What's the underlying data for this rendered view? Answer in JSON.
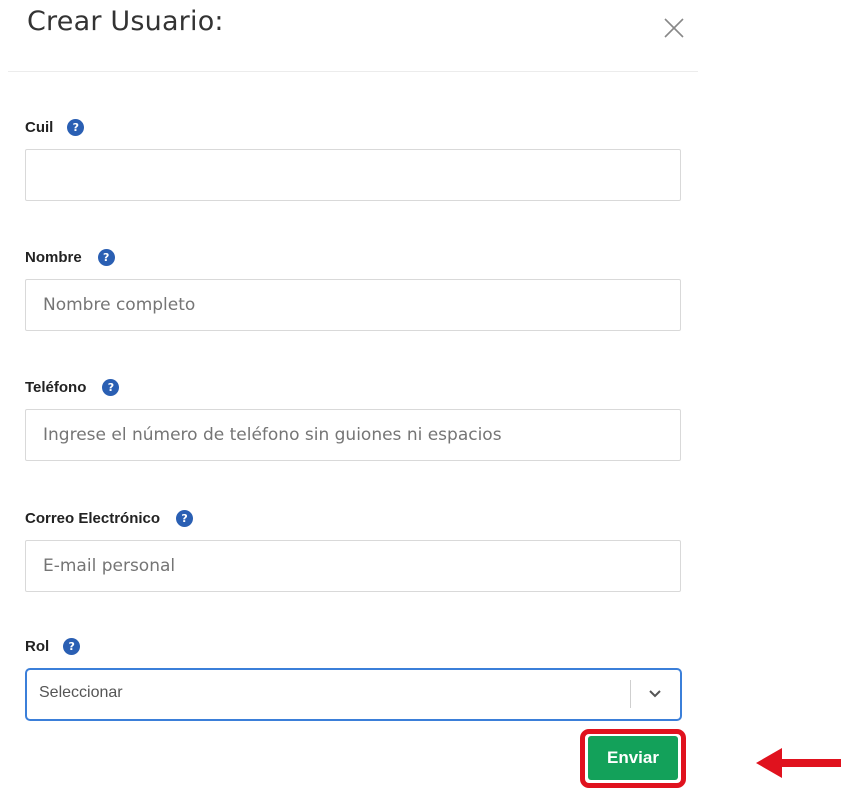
{
  "modal": {
    "title": "Crear Usuario:"
  },
  "fields": {
    "cuil": {
      "label": "Cuil",
      "value": "",
      "placeholder": ""
    },
    "nombre": {
      "label": "Nombre",
      "value": "",
      "placeholder": "Nombre completo"
    },
    "telefono": {
      "label": "Teléfono",
      "value": "",
      "placeholder": "Ingrese el número de teléfono sin guiones ni espacios"
    },
    "correo": {
      "label": "Correo Electrónico",
      "value": "",
      "placeholder": "E-mail personal"
    },
    "rol": {
      "label": "Rol",
      "selected": "Seleccionar"
    }
  },
  "help_icon_glyph": "?",
  "actions": {
    "submit_label": "Enviar"
  },
  "colors": {
    "help_icon": "#2a5fb3",
    "select_focus": "#3b7fd9",
    "submit_bg": "#13a15a",
    "highlight": "#e0121e"
  },
  "icons": {
    "close": "close-icon",
    "help": "help-icon",
    "chevron": "chevron-down-icon",
    "annotation": "red-arrow-icon"
  }
}
